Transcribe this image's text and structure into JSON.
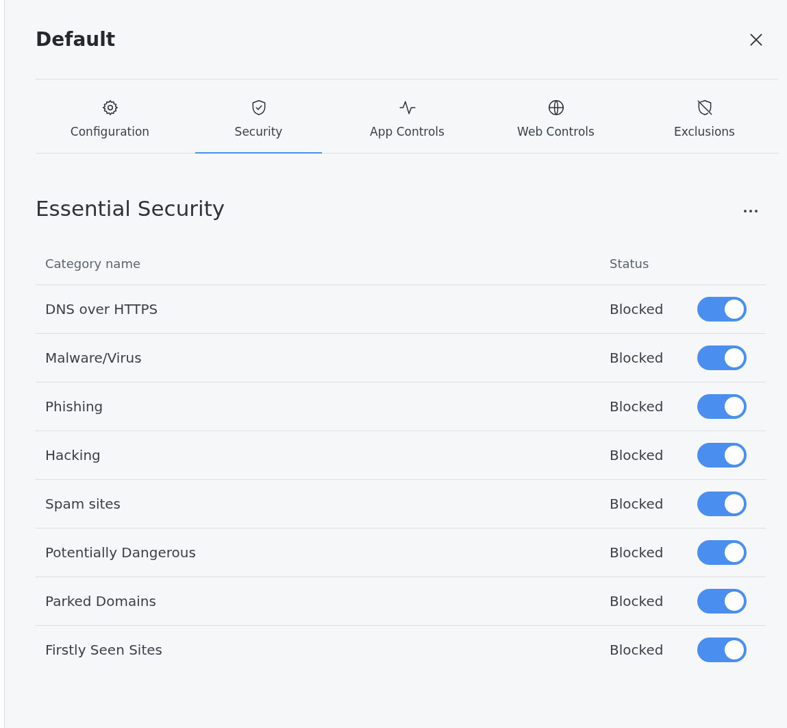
{
  "panel": {
    "title": "Default"
  },
  "tabs": [
    {
      "label": "Configuration",
      "selected": false
    },
    {
      "label": "Security",
      "selected": true
    },
    {
      "label": "App Controls",
      "selected": false
    },
    {
      "label": "Web Controls",
      "selected": false
    },
    {
      "label": "Exclusions",
      "selected": false
    }
  ],
  "section": {
    "title": "Essential Security"
  },
  "table": {
    "columns": [
      "Category name",
      "Status"
    ],
    "rows": [
      {
        "name": "DNS over HTTPS",
        "status": "Blocked",
        "on": true
      },
      {
        "name": "Malware/Virus",
        "status": "Blocked",
        "on": true
      },
      {
        "name": "Phishing",
        "status": "Blocked",
        "on": true
      },
      {
        "name": "Hacking",
        "status": "Blocked",
        "on": true
      },
      {
        "name": "Spam sites",
        "status": "Blocked",
        "on": true
      },
      {
        "name": "Potentially Dangerous",
        "status": "Blocked",
        "on": true
      },
      {
        "name": "Parked Domains",
        "status": "Blocked",
        "on": true
      },
      {
        "name": "Firstly Seen Sites",
        "status": "Blocked",
        "on": true
      }
    ]
  }
}
